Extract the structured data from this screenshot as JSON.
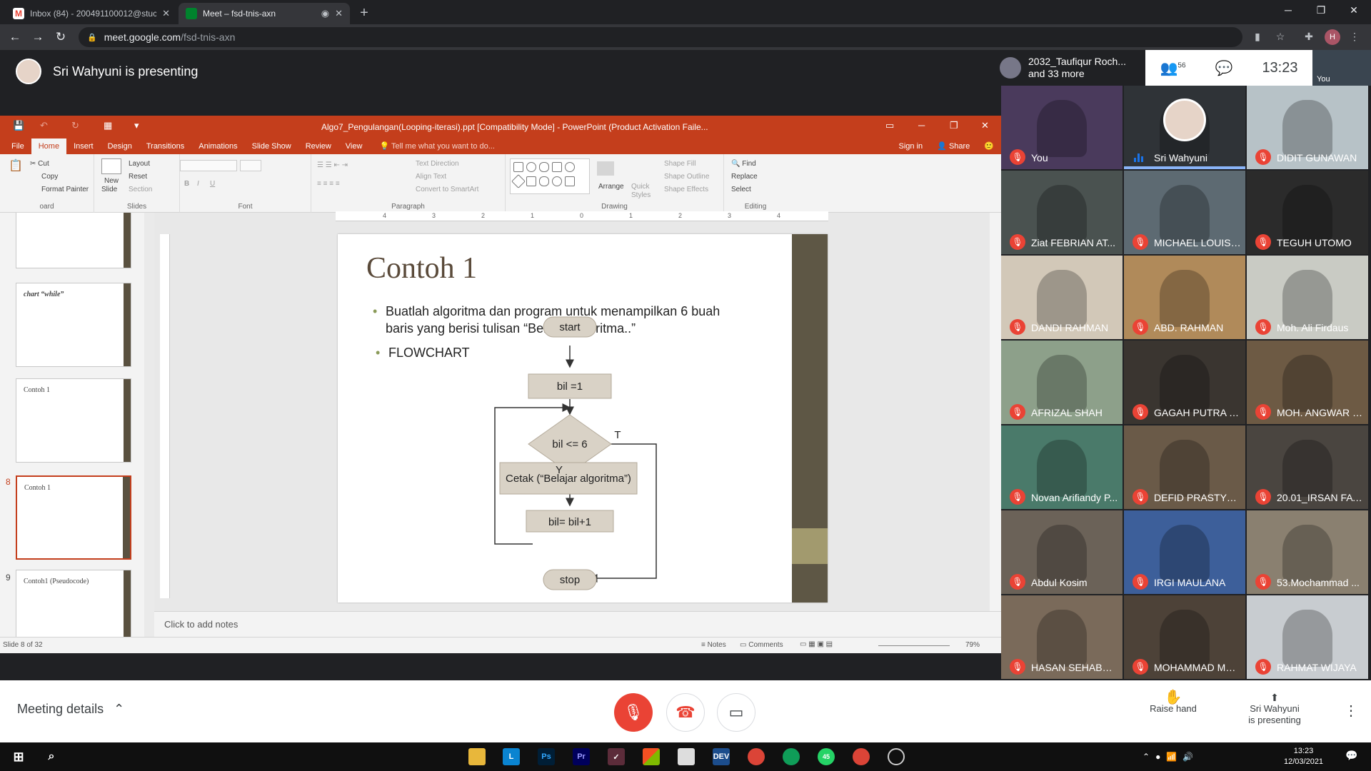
{
  "browser": {
    "tabs": [
      {
        "label": "Inbox (84) - 200491100012@stuc",
        "favicon_color": "#ea4335"
      },
      {
        "label": "Meet – fsd-tnis-axn",
        "favicon_color": "#00832d"
      }
    ],
    "url_domain": "meet.google.com",
    "url_path": "/fsd-tnis-axn",
    "profile_initial": "H"
  },
  "meet": {
    "presenting_text": "Sri Wahyuni is presenting",
    "summary_name": "2032_Taufiqur Roch...",
    "summary_more": "and 33 more",
    "participant_count": "56",
    "clock": "13:23",
    "self_label": "You",
    "meeting_details": "Meeting details",
    "raise_hand": "Raise hand",
    "presenting_name": "Sri Wahyuni",
    "presenting_label": "is presenting",
    "accent_red": "#ea4335"
  },
  "participants": [
    {
      "name": "You",
      "muted": true,
      "bg": "#4a3a5c"
    },
    {
      "name": "Sri Wahyuni",
      "muted": false,
      "bg": "#2f3337"
    },
    {
      "name": "DIDIT GUNAWAN",
      "muted": true,
      "bg": "#b7c2c7"
    },
    {
      "name": "Ziat FEBRIAN AT...",
      "muted": true,
      "bg": "#4a5250"
    },
    {
      "name": "MICHAEL LOUIS ...",
      "muted": true,
      "bg": "#5d6a72"
    },
    {
      "name": "TEGUH UTOMO",
      "muted": true,
      "bg": "#2b2b2b"
    },
    {
      "name": "DANDI RAHMAN",
      "muted": true,
      "bg": "#d2c8b8"
    },
    {
      "name": "ABD. RAHMAN",
      "muted": true,
      "bg": "#b08a5a"
    },
    {
      "name": "Moh. Ali Firdaus",
      "muted": true,
      "bg": "#c9cbc4"
    },
    {
      "name": "AFRIZAL SHAH",
      "muted": true,
      "bg": "#8da08a"
    },
    {
      "name": "GAGAH PUTRA P...",
      "muted": true,
      "bg": "#3a3530"
    },
    {
      "name": "MOH. ANGWAR R...",
      "muted": true,
      "bg": "#6d5a44"
    },
    {
      "name": "Novan Arifiandy P...",
      "muted": true,
      "bg": "#4a7a6a"
    },
    {
      "name": "DEFID PRASTYO ...",
      "muted": true,
      "bg": "#6a5a48"
    },
    {
      "name": "20.01_IRSAN FAT...",
      "muted": true,
      "bg": "#4a4540"
    },
    {
      "name": "Abdul Kosim",
      "muted": true,
      "bg": "#6b6258"
    },
    {
      "name": "IRGI MAULANA",
      "muted": true,
      "bg": "#3d5f9a"
    },
    {
      "name": "53.Mochammad ...",
      "muted": true,
      "bg": "#8a8070"
    },
    {
      "name": "HASAN SEHABUD...",
      "muted": true,
      "bg": "#7a6a5a"
    },
    {
      "name": "MOHAMMAD MU...",
      "muted": true,
      "bg": "#4d4238"
    },
    {
      "name": "RAHMAT WIJAYA",
      "muted": true,
      "bg": "#c8ccd0"
    }
  ],
  "ppt": {
    "window_title": "Algo7_Pengulangan(Looping-iterasi).ppt [Compatibility Mode] - PowerPoint (Product Activation Faile...",
    "tabs": [
      "File",
      "Home",
      "Insert",
      "Design",
      "Transitions",
      "Animations",
      "Slide Show",
      "Review",
      "View"
    ],
    "tell_me": "Tell me what you want to do...",
    "sign_in": "Sign in",
    "share": "Share",
    "ribbon": {
      "cut": "Cut",
      "copy": "Copy",
      "format_painter": "Format Painter",
      "clipboard": "oard",
      "new_slide": "New",
      "new_slide2": "Slide",
      "layout": "Layout",
      "reset": "Reset",
      "section": "Section",
      "slides": "Slides",
      "font": "Font",
      "paragraph": "Paragraph",
      "text_direction": "Text Direction",
      "align_text": "Align Text",
      "convert": "Convert to SmartArt",
      "arrange": "Arrange",
      "quick_styles": "Quick",
      "quick_styles2": "Styles",
      "shape_fill": "Shape Fill",
      "shape_outline": "Shape Outline",
      "shape_effects": "Shape Effects",
      "drawing": "Drawing",
      "find": "Find",
      "replace": "Replace",
      "select": "Select",
      "editing": "Editing"
    },
    "thumbnails": [
      {
        "num": "",
        "title": ""
      },
      {
        "num": "",
        "title": "chart “while”"
      },
      {
        "num": "",
        "title": "Contoh 1"
      },
      {
        "num": "8",
        "title": "Contoh 1"
      },
      {
        "num": "9",
        "title": "Contoh1 (Pseudocode)"
      }
    ],
    "notes_placeholder": "Click to add notes",
    "status_slide": "Slide 8 of 32",
    "status_notes": "Notes",
    "status_comments": "Comments",
    "zoom": "79%",
    "ruler_labels": [
      "4",
      "3",
      "2",
      "1",
      "0",
      "1",
      "2",
      "3",
      "4"
    ]
  },
  "slide": {
    "title": "Contoh 1",
    "bullet1_line1": "Buatlah algoritma dan program untuk menampilkan 6 buah",
    "bullet1_line2": "baris yang berisi tulisan “Belajar algoritma..”",
    "bullet2": "FLOWCHART",
    "fc_start": "start",
    "fc_init": "bil =1",
    "fc_cond": "bil <= 6",
    "fc_true": "T",
    "fc_yes": "Y",
    "fc_print": "Cetak (“Belajar algoritma”)",
    "fc_inc": "bil= bil+1",
    "fc_stop": "stop"
  },
  "taskbar": {
    "time": "13:23",
    "date": "12/03/2021",
    "whatsapp_badge": "45"
  }
}
